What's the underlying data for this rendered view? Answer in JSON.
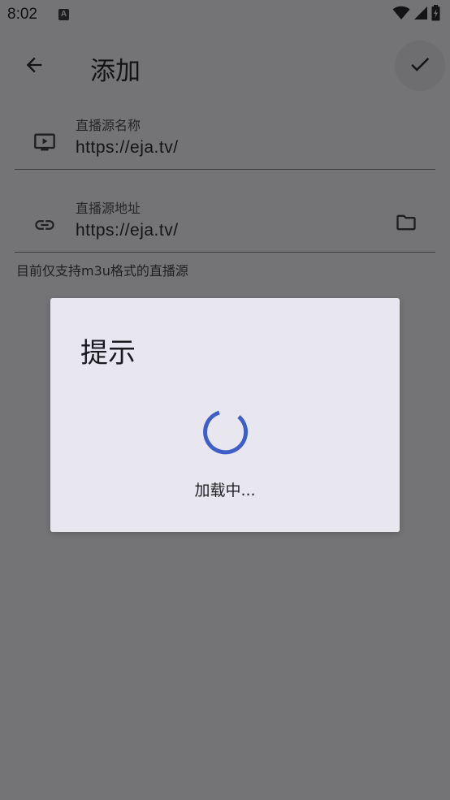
{
  "status_bar": {
    "time": "8:02",
    "notification_icon": "a-letter-icon",
    "icons": [
      "wifi-icon",
      "cellular-signal-icon",
      "battery-icon"
    ]
  },
  "app_bar": {
    "title": "添加",
    "back_icon": "arrow-left-icon",
    "confirm_icon": "check-icon"
  },
  "form": {
    "name_field": {
      "label": "直播源名称",
      "value": "https://eja.tv/",
      "icon": "tv-icon"
    },
    "url_field": {
      "label": "直播源地址",
      "value": "https://eja.tv/",
      "icon": "link-icon",
      "trailing_icon": "folder-icon"
    },
    "helper_text": "目前仅支持m3u格式的直播源"
  },
  "dialog": {
    "title": "提示",
    "message": "加载中...",
    "spinner_color": "#3f5fc8"
  },
  "colors": {
    "scrim_background": "#747476",
    "dialog_background": "#e8e7ef",
    "accent": "#3f5fc8"
  }
}
